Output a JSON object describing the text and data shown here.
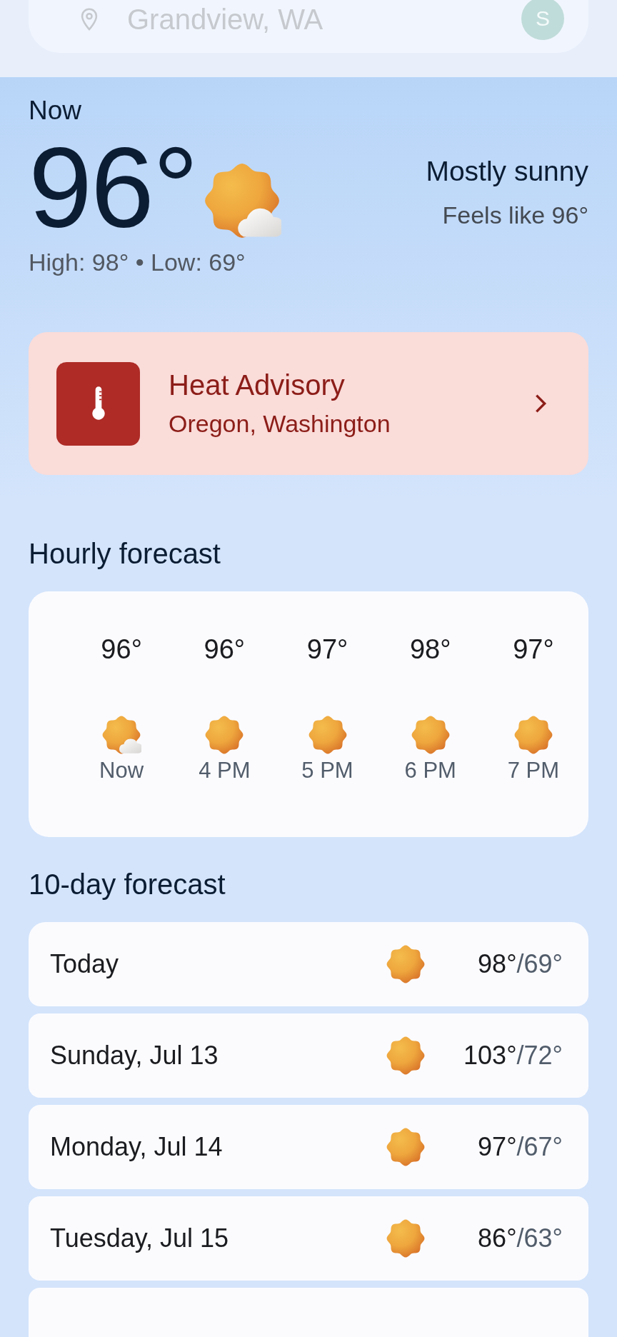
{
  "search": {
    "value": "Grandview, WA",
    "avatar": "S"
  },
  "current": {
    "label": "Now",
    "temperature": "96°",
    "kind": "partly_cloudy",
    "condition": "Mostly sunny",
    "feels_like": "Feels like 96°",
    "high_low": "High: 98° • Low: 69°"
  },
  "alert": {
    "title": "Heat Advisory",
    "regions": "Oregon, Washington"
  },
  "hourly": {
    "title": "Hourly forecast",
    "items": [
      {
        "temp": "96°",
        "kind": "partly_cloudy",
        "time": "Now"
      },
      {
        "temp": "96°",
        "kind": "sunny",
        "time": "4 PM"
      },
      {
        "temp": "97°",
        "kind": "sunny",
        "time": "5 PM"
      },
      {
        "temp": "98°",
        "kind": "sunny",
        "time": "6 PM"
      },
      {
        "temp": "97°",
        "kind": "sunny",
        "time": "7 PM"
      }
    ]
  },
  "daily": {
    "title": "10-day forecast",
    "rows": [
      {
        "day": "Today",
        "kind": "sunny",
        "high": "98°",
        "low": "/69°"
      },
      {
        "day": "Sunday, Jul 13",
        "kind": "sunny",
        "high": "103°",
        "low": "/72°"
      },
      {
        "day": "Monday, Jul 14",
        "kind": "sunny",
        "high": "97°",
        "low": "/67°"
      },
      {
        "day": "Tuesday, Jul 15",
        "kind": "sunny",
        "high": "86°",
        "low": "/63°"
      }
    ]
  }
}
